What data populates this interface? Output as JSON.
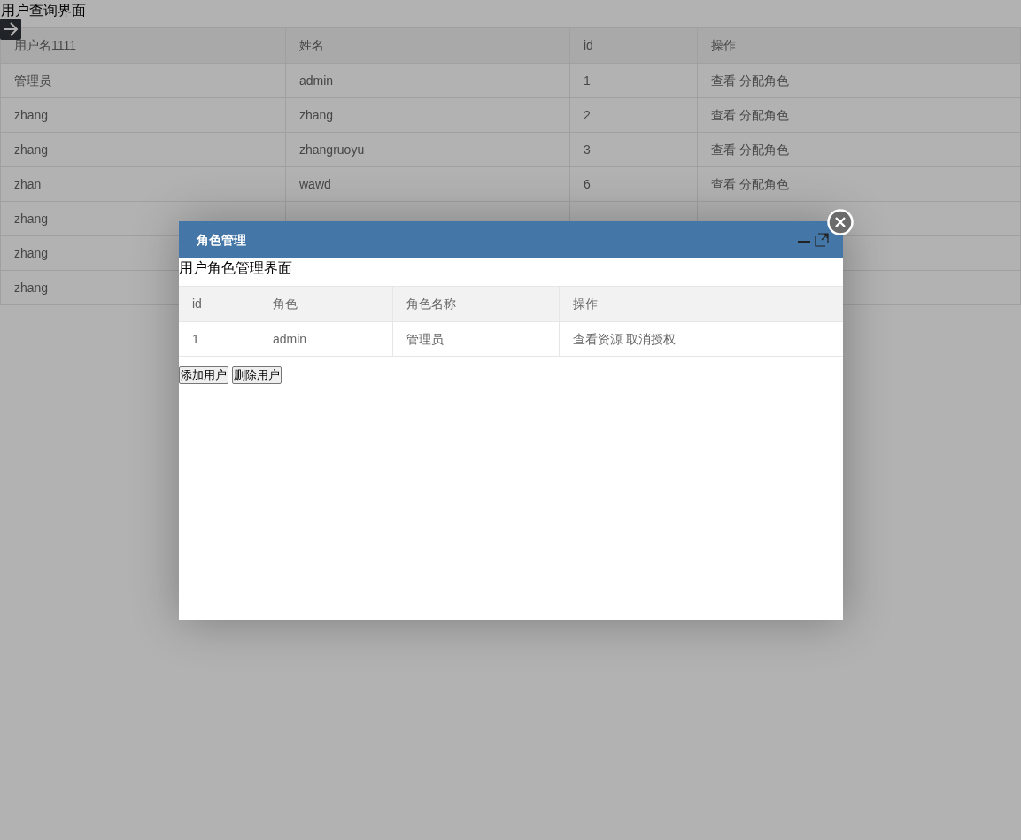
{
  "page": {
    "title": "用户查询界面",
    "table": {
      "columns": [
        "用户名1111",
        "姓名",
        "id",
        "操作"
      ],
      "rows": [
        {
          "cells": [
            "管理员",
            "admin",
            "1"
          ],
          "actions": [
            "查看",
            "分配角色"
          ]
        },
        {
          "cells": [
            "zhang",
            "zhang",
            "2"
          ],
          "actions": [
            "查看",
            "分配角色"
          ]
        },
        {
          "cells": [
            "zhang",
            "zhangruoyu",
            "3"
          ],
          "actions": [
            "查看",
            "分配角色"
          ]
        },
        {
          "cells": [
            "zhan",
            "wawd",
            "6"
          ],
          "actions": [
            "查看",
            "分配角色"
          ]
        },
        {
          "cells": [
            "zhang"
          ]
        },
        {
          "cells": [
            "zhang"
          ]
        },
        {
          "cells": [
            "zhang"
          ]
        }
      ]
    }
  },
  "dialog": {
    "title": "角色管理",
    "heading": "用户角色管理界面",
    "table": {
      "columns": [
        "id",
        "角色",
        "角色名称",
        "操作"
      ],
      "rows": [
        {
          "cells": [
            "1",
            "admin",
            "管理员"
          ],
          "actions": [
            "查看资源",
            "取消授权"
          ]
        }
      ]
    },
    "buttons": [
      "添加用户",
      "删除用户"
    ]
  }
}
